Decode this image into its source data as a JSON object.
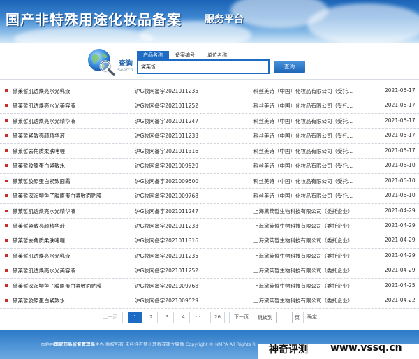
{
  "header": {
    "title": "国产非特殊用途化妆品备案",
    "subtitle": "服务平台"
  },
  "search": {
    "label": "查询",
    "sublabel": "Search",
    "tabs": [
      {
        "label": "产品名称",
        "active": true
      },
      {
        "label": "备案编号",
        "active": false
      },
      {
        "label": "单位名称",
        "active": false
      }
    ],
    "value": "黛莱皙",
    "button_label": "查询"
  },
  "results": [
    {
      "name": "黛莱皙肌透焕亮水光乳液",
      "reg": "沪G妆网备字2021011235",
      "company": "科丝美诗（中国）化妆品有限公司（受托...",
      "date": "2021-05-17"
    },
    {
      "name": "黛莱皙肌透焕亮水光美容液",
      "reg": "沪G妆网备字2021011252",
      "company": "科丝美诗（中国）化妆品有限公司（受托...",
      "date": "2021-05-17"
    },
    {
      "name": "黛莱皙肌透焕亮水光精华液",
      "reg": "沪G妆网备字2021011247",
      "company": "科丝美诗（中国）化妆品有限公司（受托...",
      "date": "2021-05-17"
    },
    {
      "name": "黛莱皙紧致亮颜精华液",
      "reg": "沪G妆网备字2021011233",
      "company": "科丝美诗（中国）化妆品有限公司（受托...",
      "date": "2021-05-17"
    },
    {
      "name": "黛莱皙去角质柔肤啫喱",
      "reg": "沪G妆网备字2021011316",
      "company": "科丝美诗（中国）化妆品有限公司（受托...",
      "date": "2021-05-17"
    },
    {
      "name": "黛莱皙胶原蛋白紧致水",
      "reg": "沪G妆网备字2021009529",
      "company": "科丝美诗（中国）化妆品有限公司（受托...",
      "date": "2021-05-10"
    },
    {
      "name": "黛莱皙胶原蛋白紧致面霜",
      "reg": "沪G妆网备字2021009500",
      "company": "科丝美诗（中国）化妆品有限公司（受托...",
      "date": "2021-05-10"
    },
    {
      "name": "黛莱皙深海鲟鱼子胶原蛋白紧致面贴膜",
      "reg": "沪G妆网备字2021009768",
      "company": "科丝美诗（中国）化妆品有限公司（受托...",
      "date": "2021-05-10"
    },
    {
      "name": "黛莱皙肌透焕亮水光精华液",
      "reg": "沪G妆网备字2021011247",
      "company": "上海黛莱皙生物科技有限公司（委托企业）",
      "date": "2021-04-29"
    },
    {
      "name": "黛莱皙紧致亮颜精华液",
      "reg": "沪G妆网备字2021011233",
      "company": "上海黛莱皙生物科技有限公司（委托企业）",
      "date": "2021-04-29"
    },
    {
      "name": "黛莱皙去角质柔肤啫喱",
      "reg": "沪G妆网备字2021011316",
      "company": "上海黛莱皙生物科技有限公司（委托企业）",
      "date": "2021-04-29"
    },
    {
      "name": "黛莱皙肌透焕亮水光乳液",
      "reg": "沪G妆网备字2021011235",
      "company": "上海黛莱皙生物科技有限公司（委托企业）",
      "date": "2021-04-29"
    },
    {
      "name": "黛莱皙肌透焕亮水光美容液",
      "reg": "沪G妆网备字2021011252",
      "company": "上海黛莱皙生物科技有限公司（委托企业）",
      "date": "2021-04-29"
    },
    {
      "name": "黛莱皙深海鲟鱼子胶原蛋白紧致面贴膜",
      "reg": "沪G妆网备字2021009768",
      "company": "上海黛莱皙生物科技有限公司（委托企业）",
      "date": "2021-04-25"
    },
    {
      "name": "黛莱皙胶原蛋白紧致水",
      "reg": "沪G妆网备字2021009529",
      "company": "上海黛莱皙生物科技有限公司（委托企业）",
      "date": "2021-04-22"
    }
  ],
  "pager": {
    "prev": "上一页",
    "pages": [
      "1",
      "2",
      "3",
      "4"
    ],
    "current": "1",
    "dots": "...",
    "last": "26",
    "next": "下一页",
    "jump_label": "跳转到",
    "page_unit": "页",
    "confirm": "确定"
  },
  "footer": {
    "prefix": "本站由",
    "org": "国家药品监督管理局",
    "suffix": "主办 版权所有 未经许可禁止转载或建立镜像 Copyright © NMPA All Rights R"
  },
  "watermark": {
    "cn": "神奇评测",
    "en": "www.vssq.cn"
  },
  "colors": {
    "accent": "#1d6bc2",
    "bullet": "#c92a2a",
    "footer": "#3f86cf"
  }
}
